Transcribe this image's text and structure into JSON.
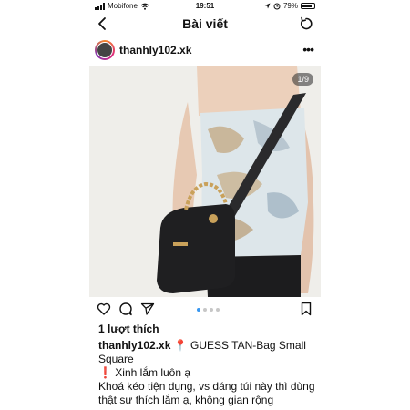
{
  "status_bar": {
    "carrier": "Mobifone",
    "time": "19:51",
    "battery": "79%",
    "battery_level": 0.79
  },
  "nav": {
    "title": "Bài viết",
    "back_icon": "chevron-left-icon",
    "refresh_icon": "refresh-icon"
  },
  "post": {
    "username": "thanhly102.xk",
    "image_counter": "1/9",
    "likes": "1 lượt thích",
    "caption_username": "thanhly102.xk",
    "caption_line1": " GUESS TAN-Bag Small Square",
    "caption_line2": "Xinh lắm luôn ạ",
    "caption_line3": "Khoá kéo tiện dụng, vs dáng túi này thì dùng thật sự thích lắm ạ, không gian rộng",
    "pin_icon": "pin-icon",
    "exclaim_icon": "exclamation-icon"
  },
  "carousel": {
    "count": 4,
    "active": 1
  },
  "colors": {
    "accent": "#3897f0",
    "pin": "#e0245e"
  }
}
